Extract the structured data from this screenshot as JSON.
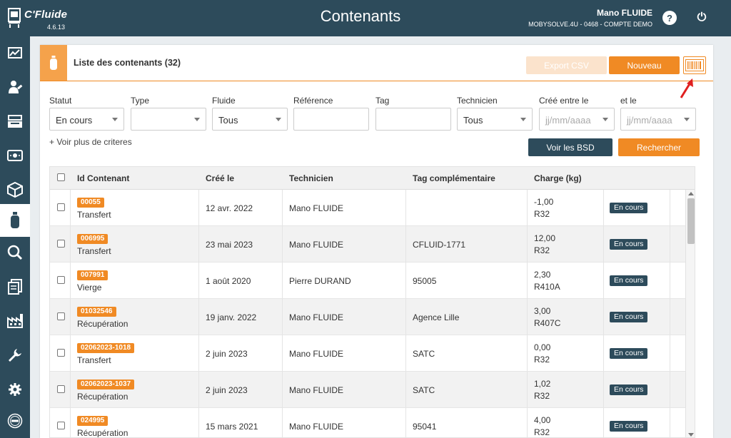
{
  "app": {
    "name": "C'Fluide",
    "version": "4.6.13",
    "title": "Contenants"
  },
  "user": {
    "name": "Mano FLUIDE",
    "account": "MOBYSOLVE.4U - 0468 - COMPTE DEMO"
  },
  "header": {
    "help": "?",
    "power": "⏻"
  },
  "colors": {
    "navy": "#2d4b5b",
    "orange": "#f08a24"
  },
  "sidebar": {
    "items": [
      {
        "icon": "chart-icon"
      },
      {
        "icon": "technician-icon"
      },
      {
        "icon": "register-icon"
      },
      {
        "icon": "cash-icon"
      },
      {
        "icon": "box-icon"
      },
      {
        "icon": "cylinder-icon",
        "active": true
      },
      {
        "icon": "search-icon"
      },
      {
        "icon": "documents-icon"
      },
      {
        "icon": "factory-icon"
      },
      {
        "icon": "wrench-icon"
      },
      {
        "icon": "gear-icon"
      },
      {
        "icon": "track-icon"
      }
    ]
  },
  "panel": {
    "title": "Liste des contenants (32)",
    "export_label": "Export CSV",
    "new_label": "Nouveau"
  },
  "filters": {
    "statut": {
      "label": "Statut",
      "value": "En cours"
    },
    "type": {
      "label": "Type",
      "value": ""
    },
    "fluide": {
      "label": "Fluide",
      "value": "Tous"
    },
    "reference": {
      "label": "Référence",
      "value": ""
    },
    "tag": {
      "label": "Tag",
      "value": ""
    },
    "technicien": {
      "label": "Technicien",
      "value": "Tous"
    },
    "cree_entre": {
      "label": "Créé entre le",
      "placeholder": "jj/mm/aaaa"
    },
    "et_le": {
      "label": "et le",
      "placeholder": "jj/mm/aaaa"
    },
    "more": "+ Voir plus de criteres",
    "bsd_label": "Voir les BSD",
    "search_label": "Rechercher"
  },
  "table": {
    "columns": [
      "Id Contenant",
      "Créé le",
      "Technicien",
      "Tag complémentaire",
      "Charge (kg)"
    ],
    "rows": [
      {
        "id": "00055",
        "type": "Transfert",
        "created": "12 avr. 2022",
        "tech": "Mano FLUIDE",
        "tag": "",
        "charge": "-1,00",
        "fluid": "R32",
        "status": "En cours"
      },
      {
        "id": "006995",
        "type": "Transfert",
        "created": "23 mai 2023",
        "tech": "Mano FLUIDE",
        "tag": "CFLUID-1771",
        "charge": "12,00",
        "fluid": "R32",
        "status": "En cours"
      },
      {
        "id": "007991",
        "type": "Vierge",
        "created": "1 août 2020",
        "tech": "Pierre DURAND",
        "tag": "95005",
        "charge": "2,30",
        "fluid": "R410A",
        "status": "En cours"
      },
      {
        "id": "01032546",
        "type": "Récupération",
        "created": "19 janv. 2022",
        "tech": "Mano FLUIDE",
        "tag": "Agence Lille",
        "charge": "3,00",
        "fluid": "R407C",
        "status": "En cours"
      },
      {
        "id": "02062023-1018",
        "type": "Transfert",
        "created": "2 juin 2023",
        "tech": "Mano FLUIDE",
        "tag": "SATC",
        "charge": "0,00",
        "fluid": "R32",
        "status": "En cours"
      },
      {
        "id": "02062023-1037",
        "type": "Récupération",
        "created": "2 juin 2023",
        "tech": "Mano FLUIDE",
        "tag": "SATC",
        "charge": "1,02",
        "fluid": "R32",
        "status": "En cours"
      },
      {
        "id": "024995",
        "type": "Récupération",
        "created": "15 mars 2021",
        "tech": "Mano FLUIDE",
        "tag": "95041",
        "charge": "4,00",
        "fluid": "R32",
        "status": "En cours"
      }
    ]
  }
}
